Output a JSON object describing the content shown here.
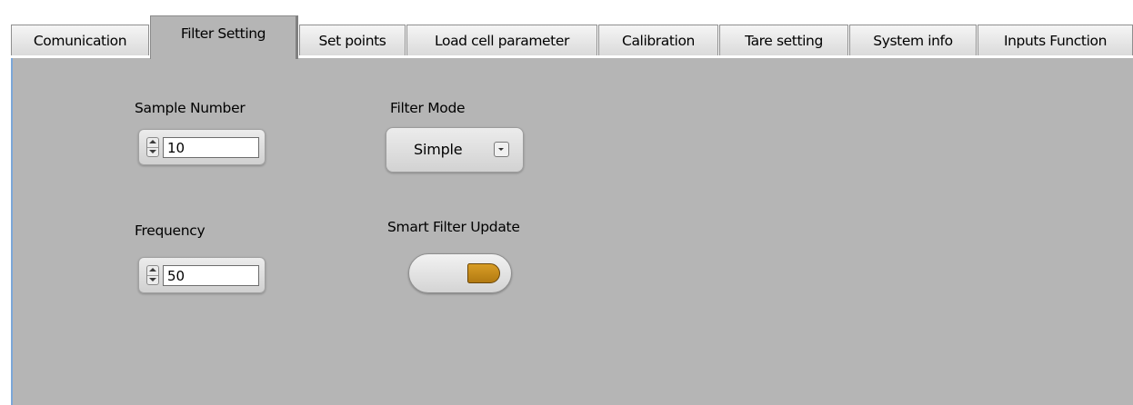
{
  "tabs": [
    {
      "label": "Comunication",
      "active": false
    },
    {
      "label": "Filter Setting",
      "active": true
    },
    {
      "label": "Set points",
      "active": false
    },
    {
      "label": "Load cell parameter",
      "active": false
    },
    {
      "label": "Calibration",
      "active": false
    },
    {
      "label": "Tare setting",
      "active": false
    },
    {
      "label": "System info",
      "active": false
    },
    {
      "label": "Inputs Function",
      "active": false
    }
  ],
  "filter_setting": {
    "sample_number": {
      "label": "Sample Number",
      "value": "10"
    },
    "frequency": {
      "label": "Frequency",
      "value": "50"
    },
    "filter_mode": {
      "label": "Filter Mode",
      "value": "Simple"
    },
    "smart_filter_update": {
      "label": "Smart Filter Update",
      "state": "on"
    }
  },
  "icons": {
    "spinner": "up-down-arrow-icon",
    "ring_dropdown": "dropdown-arrow-icon"
  },
  "colors": {
    "panel_background": "#b5b5b5",
    "led_on": "#c88a1a",
    "panel_left_accent": "#7ba7d9"
  }
}
